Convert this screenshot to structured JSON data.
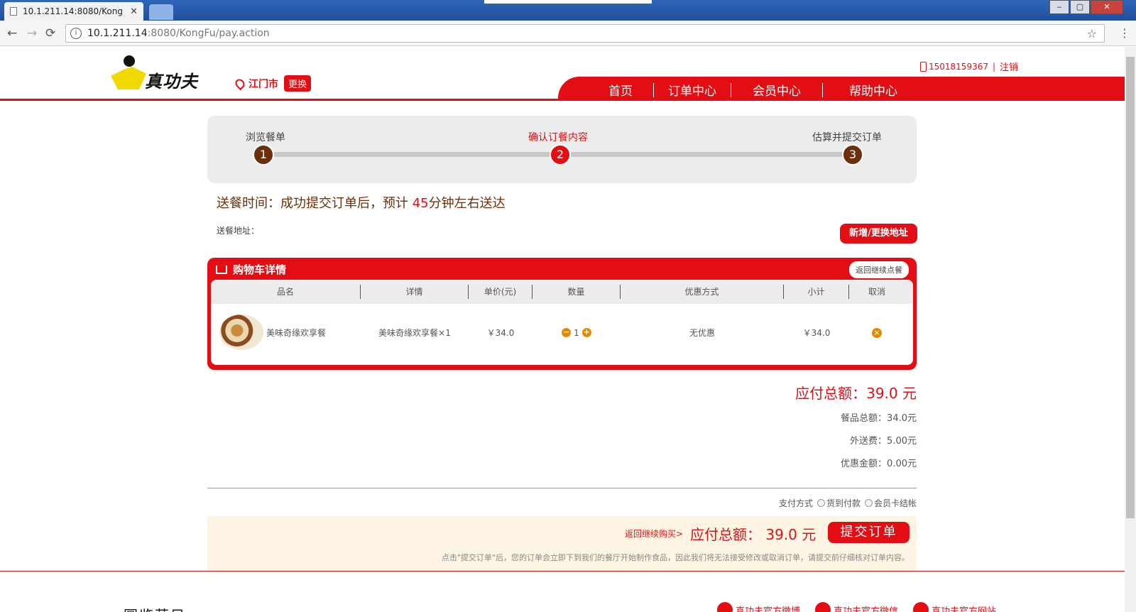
{
  "browser": {
    "tab_title": "10.1.211.14:8080/Kong",
    "tab_close": "✕",
    "url_host": "10.1.211.14",
    "url_path": ":8080/KongFu/pay.action",
    "back": "←",
    "forward": "→",
    "reload": "⟳",
    "star": "☆",
    "menu": "⋮",
    "win_min": "‒",
    "win_max": "▢",
    "win_close": "✕"
  },
  "header": {
    "logo_text": "真功夫",
    "city": "江门市",
    "change_city": "更换",
    "phone": "15018159367",
    "separator": "|",
    "logout": "注销",
    "nav": [
      "首页",
      "订单中心",
      "会员中心",
      "帮助中心"
    ]
  },
  "steps": [
    {
      "label": "浏览餐单",
      "num": "1"
    },
    {
      "label": "确认订餐内容",
      "num": "2",
      "active": true
    },
    {
      "label": "估算并提交订单",
      "num": "3"
    }
  ],
  "delivery": {
    "prefix": "送餐时间：成功提交订单后，预计 ",
    "minutes": "45",
    "suffix": "分钟左右送达",
    "address_label": "送餐地址：",
    "address_button": "新增/更换地址"
  },
  "cart": {
    "title": "购物车详情",
    "back_button": "返回继续点餐",
    "columns": [
      "品名",
      "详情",
      "单价(元)",
      "数量",
      "优惠方式",
      "小计",
      "取消"
    ],
    "row": {
      "name": "美味奇缘欢享餐",
      "detail": "美味奇缘欢享餐×1",
      "price": "￥34.0",
      "qty": "1",
      "qty_minus": "−",
      "qty_plus": "+",
      "discount": "无优惠",
      "subtotal": "￥34.0",
      "cancel": "×"
    }
  },
  "totals": {
    "payable": "应付总额：39.0 元",
    "food_total": "餐品总额：34.0元",
    "delivery_fee": "外送费：5.00元",
    "discount": "优惠金额：0.00元"
  },
  "payment": {
    "label": "支付方式",
    "option1": "货到付款",
    "option2": "会员卡结帐"
  },
  "submit": {
    "continue_link": "返回继续购买>",
    "payable": "应付总额： 39.0 元",
    "button": "提交订单",
    "notice": "点击\"提交订单\"后，您的订单会立即下到我们的餐厅开始制作食品，因此我们将无法接受修改或取消订单，请提交前仔细核对订单内容。"
  },
  "footer": {
    "qr_text": "圆览营目",
    "link1": "真功夫官方微博",
    "link2": "真功夫官方微信",
    "link3": "真功夫官方网站"
  },
  "colors": {
    "brand_red": "#e30e14",
    "step_brown": "#6b2f0c",
    "accent_orange": "#e08a00"
  }
}
